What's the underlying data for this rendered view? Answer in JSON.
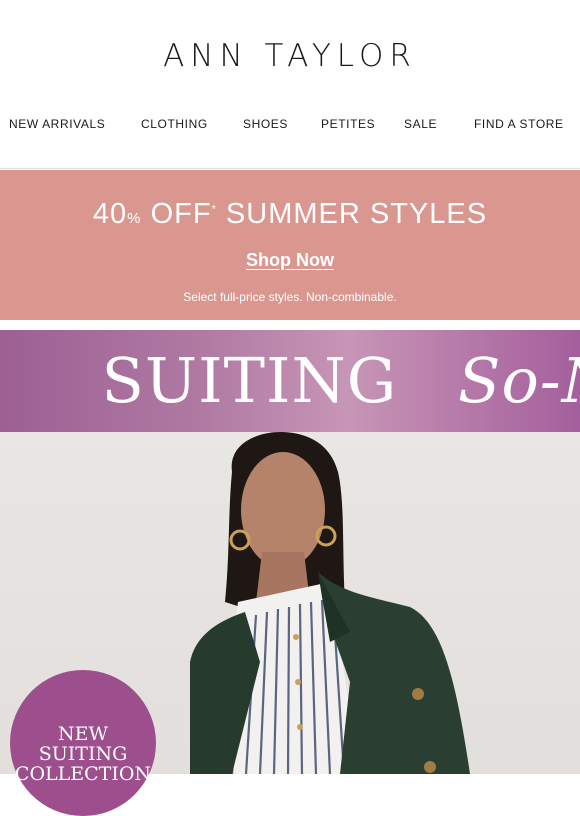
{
  "brand": {
    "logo": "ANN TAYLOR"
  },
  "nav": {
    "items": [
      {
        "label": "NEW ARRIVALS"
      },
      {
        "label": "CLOTHING"
      },
      {
        "label": "SHOES"
      },
      {
        "label": "PETITES"
      },
      {
        "label": "SALE"
      },
      {
        "label": "FIND A STORE"
      }
    ]
  },
  "promo": {
    "headline_percent": "40",
    "headline_percent_sign": "%",
    "headline_off": "OFF",
    "headline_rest": "SUMMER STYLES",
    "cta": "Shop Now",
    "fine_print": "Select full-price styles. Non-combinable.",
    "background": "#da9790"
  },
  "banner": {
    "text_1": "SUITING",
    "text_2": "So-New",
    "background_colors": [
      "#9d5f93",
      "#c795b6",
      "#a45f9c"
    ]
  },
  "hero": {
    "badge": {
      "line_1": "NEW SUITING",
      "line_2": "COLLECTION",
      "color": "#9c4f8c"
    }
  }
}
